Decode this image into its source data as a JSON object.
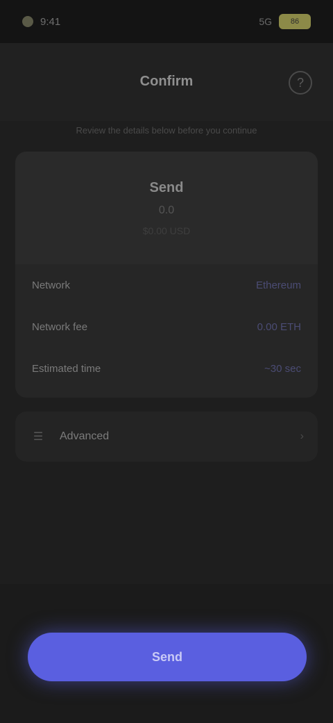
{
  "status_bar": {
    "time": "9:41",
    "signal": "5G",
    "battery": "86"
  },
  "header": {
    "title": "Confirm",
    "help_icon": "question-circle-icon",
    "subtitle": "Review the details below before you continue"
  },
  "summary": {
    "amount_label": "Send",
    "amount_value": "0.0",
    "amount_fiat": "$0.00 USD"
  },
  "details": [
    {
      "label": "Network",
      "value": "Ethereum"
    },
    {
      "label": "Network fee",
      "value": "0.00 ETH"
    },
    {
      "label": "Estimated time",
      "value": "~30 sec"
    }
  ],
  "advanced": {
    "icon": "sliders-icon",
    "label": "Advanced",
    "chevron_icon": "chevron-right-icon"
  },
  "footer": {
    "primary_label": "Send"
  },
  "colors": {
    "accent": "#5a5fe0",
    "background": "#1e1e1e",
    "card": "#262626"
  }
}
